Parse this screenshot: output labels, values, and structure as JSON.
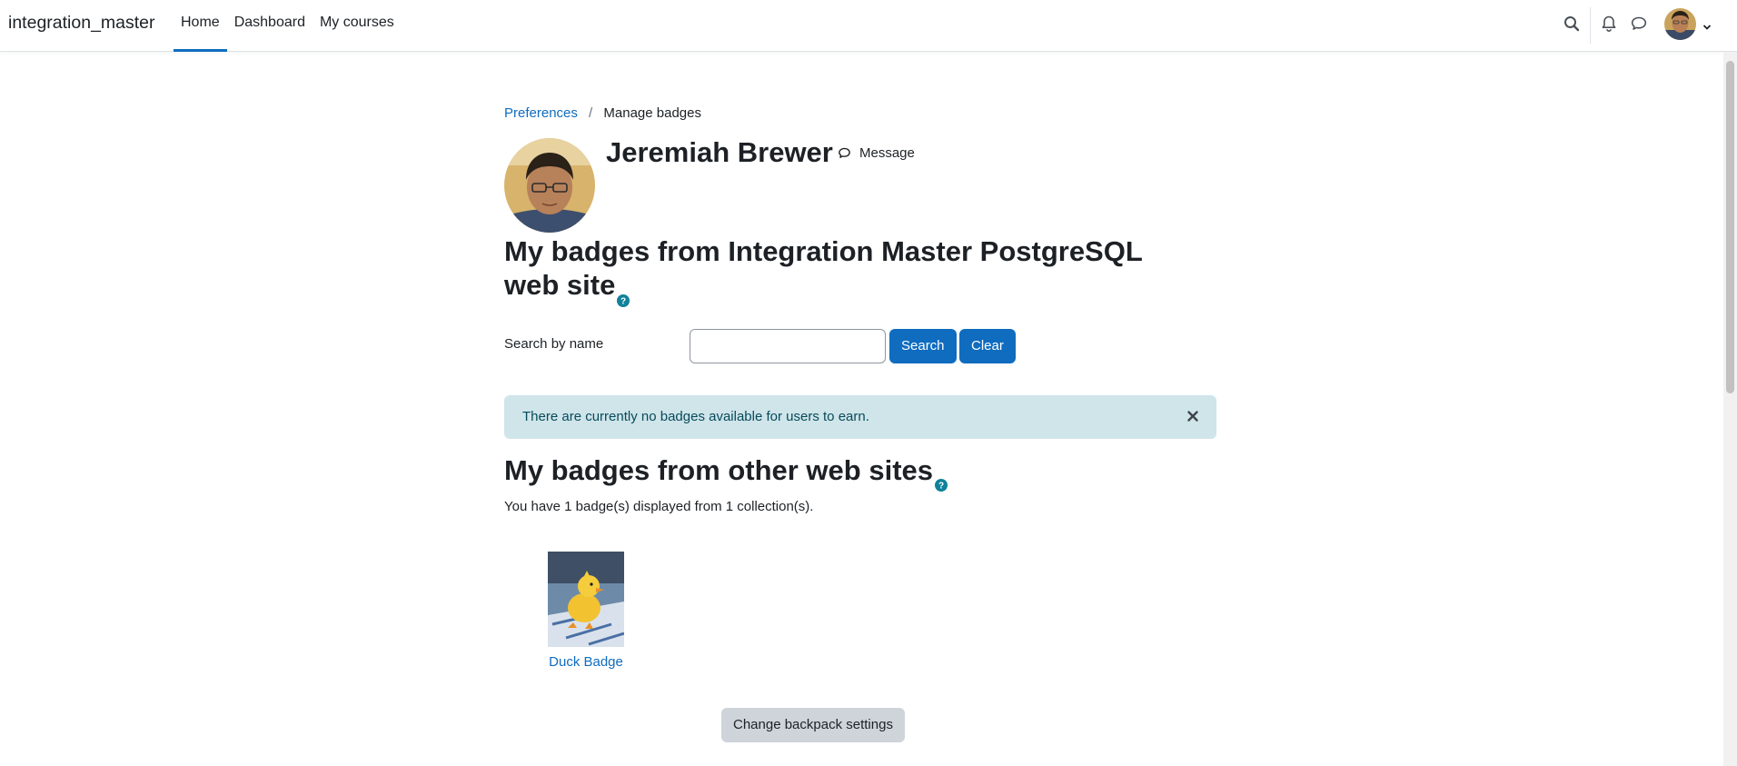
{
  "navbar": {
    "brand": "integration_master",
    "links": [
      {
        "label": "Home",
        "active": true
      },
      {
        "label": "Dashboard",
        "active": false
      },
      {
        "label": "My courses",
        "active": false
      }
    ],
    "icons": [
      "search-icon",
      "bell-icon",
      "chat-icon",
      "avatar",
      "chevron-down-icon"
    ]
  },
  "breadcrumb": {
    "parent": "Preferences",
    "separator": "/",
    "current": "Manage badges"
  },
  "profile": {
    "name": "Jeremiah Brewer",
    "message_label": "Message"
  },
  "site_badges": {
    "heading": "My badges from Integration Master PostgreSQL web site",
    "search_label": "Search by name",
    "search_value": "",
    "search_button": "Search",
    "clear_button": "Clear",
    "alert_text": "There are currently no badges available for users to earn."
  },
  "other_badges": {
    "heading": "My badges from other web sites",
    "collection_text": "You have 1 badge(s) displayed from 1 collection(s).",
    "badges": [
      {
        "name": "Duck Badge"
      }
    ],
    "backpack_button": "Change backpack settings"
  },
  "colors": {
    "accent": "#0f6cbf",
    "alert_bg": "#cfe5ea",
    "alert_text": "#084a5a",
    "help_icon": "#0f8299"
  }
}
